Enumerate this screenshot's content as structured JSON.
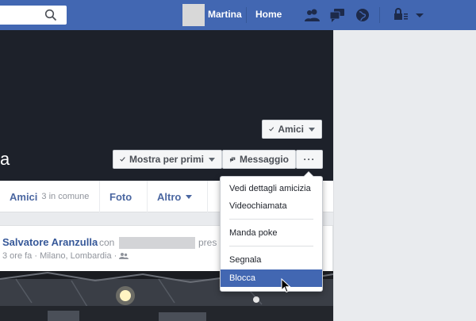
{
  "topbar": {
    "user_name": "Martina",
    "home_label": "Home",
    "icons": [
      "search-icon",
      "friends-icon",
      "messages-icon",
      "notifications-globe-icon",
      "privacy-lock-icon",
      "account-menu-chevron-icon"
    ]
  },
  "profile": {
    "name_fragment": "a",
    "friends_button": "Amici",
    "follow_first_button": "Mostra per primi",
    "message_button": "Messaggio",
    "more_button": "···"
  },
  "tabs": [
    {
      "label": "Amici",
      "sub": "3 in comune"
    },
    {
      "label": "Foto",
      "sub": ""
    },
    {
      "label": "Altro",
      "sub": ""
    }
  ],
  "post": {
    "author": "Salvatore Aranzulla",
    "with_text": "con",
    "presso_text": "pres",
    "meta": "3 ore fa · Milano, Lombardia ·"
  },
  "dropdown": {
    "items": [
      "Vedi dettagli amicizia",
      "Videochiamata",
      "Manda poke",
      "Segnala",
      "Blocca"
    ],
    "highlighted": "Blocca"
  },
  "colors": {
    "brand": "#4267b2",
    "cover": "#1d212a",
    "link": "#365899"
  }
}
